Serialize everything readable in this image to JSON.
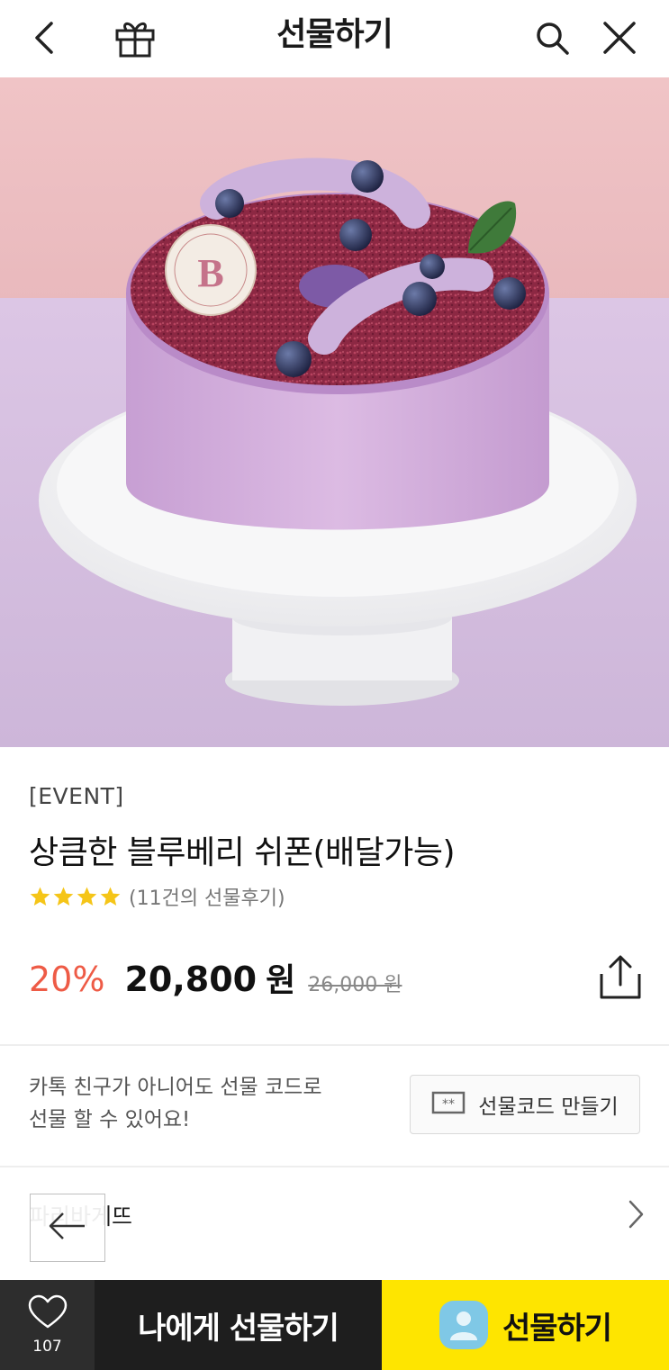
{
  "header": {
    "title": "선물하기",
    "icons": [
      "back-icon",
      "gift-icon",
      "search-icon",
      "close-icon"
    ]
  },
  "product": {
    "image_alt": "블루베리 쉬폰 케이크",
    "image_logo": "PARIS BAGUETTE BOULANGERIE",
    "event_tag": "[EVENT]",
    "title": "상큼한 블루베리 쉬폰(배달가능)",
    "rating": {
      "stars": 4,
      "max": 5,
      "review_text": "(11건의 선물후기)"
    },
    "price": {
      "discount": "20%",
      "sale_price": "20,800",
      "unit": "원",
      "original_price": "26,000 원"
    }
  },
  "gift_code": {
    "line1": "카톡 친구가 아니어도 선물 코드로",
    "line2": "선물 할 수 있어요!",
    "button_label": "선물코드 만들기"
  },
  "brand": {
    "name": "파리바게뜨"
  },
  "bottom_bar": {
    "wish_count": "107",
    "self_gift_label": "나에게 선물하기",
    "gift_label": "선물하기"
  },
  "colors": {
    "discount": "#ee5b46",
    "star": "#f5c518",
    "gift_button": "#fee500",
    "self_gift_button": "#1e1e1e"
  }
}
